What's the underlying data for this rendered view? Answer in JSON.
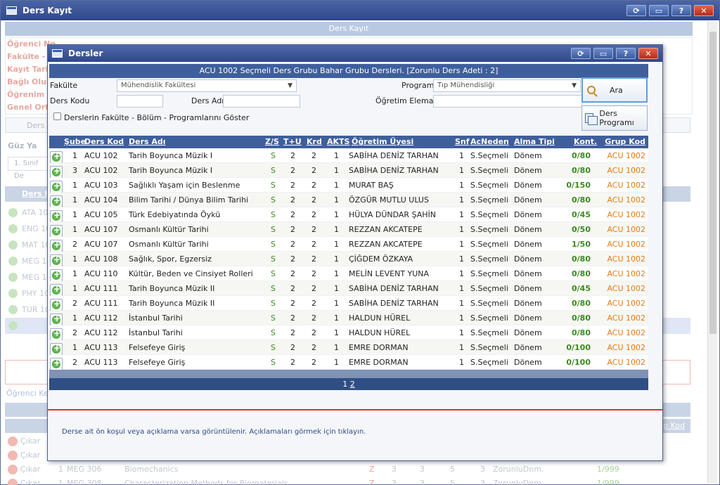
{
  "window": {
    "title": "Ders Kayıt",
    "header": "Ders Kayıt"
  },
  "background": {
    "info_rows": [
      "Öğrenci No",
      "Fakülte - P",
      "Kayıt Tarih",
      "Bağlı Olunan",
      "Öğrenim Sü",
      "Genel Orta"
    ],
    "bar_text": "Ders",
    "season": "Güz Ya",
    "class_combo": "1. Sınıf De",
    "band_label": "Ders K",
    "codes": [
      "ATA 10",
      "ENG 10",
      "MAT 10",
      "MEG 10",
      "MEG 10",
      "PHY 10",
      "TUR 10",
      ""
    ],
    "kesin": "Öğrenci Kesi",
    "grup_kod": "rup Kod",
    "bottom_rows": [
      {
        "label": "Çıkar",
        "sube": "",
        "kod": "",
        "ad": "",
        "zs": "",
        "a": "",
        "b": "",
        "c": "",
        "d": "",
        "acn": "",
        "kont": ""
      },
      {
        "label": "Çıkar",
        "sube": "",
        "kod": "",
        "ad": "",
        "zs": "",
        "a": "",
        "b": "",
        "c": "",
        "d": "",
        "acn": "",
        "kont": ""
      },
      {
        "label": "Çıkar",
        "sube": "1",
        "kod": "MEG 306",
        "ad": "Biomechanics",
        "zs": "Z",
        "a": "3",
        "b": "3",
        "c": "5",
        "d": "3",
        "acn": "ZorunluDnm.",
        "kont": "1/999"
      },
      {
        "label": "Çıkar",
        "sube": "1",
        "kod": "MEG 308",
        "ad": "Characterization Methods for Biomaterials",
        "zs": "Z",
        "a": "3",
        "b": "3",
        "c": "5",
        "d": "3",
        "acn": "ZorunluDnm.",
        "kont": "1/999"
      }
    ]
  },
  "dialog": {
    "title": "Dersler",
    "header": "ACU 1002 Seçmeli Ders Grubu Bahar Grubu Dersleri. [Zorunlu Ders Adeti : 2]",
    "form": {
      "fakulte_label": "Fakülte",
      "fakulte_value": "Mühendislik Fakültesi",
      "program_label": "Program",
      "program_value": "Tıp Mühendisliği",
      "ders_kodu_label": "Ders Kodu",
      "ders_adi_label": "Ders Adı",
      "ogretim_label": "Öğretim Elemanı",
      "checkbox_label": "Derslerin Fakülte - Bölüm - Programlarını Göster",
      "ara_label": "Ara",
      "ders_programi_label": "Ders Programı"
    },
    "columns": {
      "sube": "Şube",
      "kod": "Ders Kod",
      "ad": "Ders Adı",
      "zs": "Z/S",
      "tu": "T+U",
      "krd": "Krd",
      "akts": "AKTS",
      "ogr": "Öğretim Üyesi",
      "snf": "Snf",
      "acn": "AcNeden",
      "alma": "Alma Tipi",
      "kont": "Kont.",
      "grup": "Grup Kod"
    },
    "rows": [
      {
        "sube": "1",
        "kod": "ACU 102",
        "ad": "Tarih Boyunca Müzik I",
        "zs": "S",
        "tu": "2",
        "krd": "2",
        "akts": "1",
        "ogr": "SABİHA DENİZ TARHAN",
        "snf": "1",
        "acn": "S.Seçmeli",
        "alma": "Dönem",
        "kont": "0/80",
        "grup": "ACU 1002"
      },
      {
        "sube": "3",
        "kod": "ACU 102",
        "ad": "Tarih Boyunca Müzik I",
        "zs": "S",
        "tu": "2",
        "krd": "2",
        "akts": "1",
        "ogr": "SABİHA DENİZ TARHAN",
        "snf": "1",
        "acn": "S.Seçmeli",
        "alma": "Dönem",
        "kont": "0/80",
        "grup": "ACU 1002"
      },
      {
        "sube": "1",
        "kod": "ACU 103",
        "ad": "Sağlıklı Yaşam için Beslenme",
        "zs": "S",
        "tu": "2",
        "krd": "2",
        "akts": "1",
        "ogr": "MURAT BAŞ",
        "snf": "1",
        "acn": "S.Seçmeli",
        "alma": "Dönem",
        "kont": "0/150",
        "grup": "ACU 1002"
      },
      {
        "sube": "1",
        "kod": "ACU 104",
        "ad": "Bilim Tarihi / Dünya Bilim Tarihi",
        "zs": "S",
        "tu": "2",
        "krd": "2",
        "akts": "1",
        "ogr": "ÖZGÜR MUTLU ULUS",
        "snf": "1",
        "acn": "S.Seçmeli",
        "alma": "Dönem",
        "kont": "0/80",
        "grup": "ACU 1002"
      },
      {
        "sube": "1",
        "kod": "ACU 105",
        "ad": "Türk Edebiyatında Öykü",
        "zs": "S",
        "tu": "2",
        "krd": "2",
        "akts": "1",
        "ogr": "HÜLYA DÜNDAR ŞAHİN",
        "snf": "1",
        "acn": "S.Seçmeli",
        "alma": "Dönem",
        "kont": "0/45",
        "grup": "ACU 1002"
      },
      {
        "sube": "1",
        "kod": "ACU 107",
        "ad": "Osmanlı Kültür Tarihi",
        "zs": "S",
        "tu": "2",
        "krd": "2",
        "akts": "1",
        "ogr": "REZZAN AKCATEPE",
        "snf": "1",
        "acn": "S.Seçmeli",
        "alma": "Dönem",
        "kont": "0/50",
        "grup": "ACU 1002"
      },
      {
        "sube": "2",
        "kod": "ACU 107",
        "ad": "Osmanlı Kültür Tarihi",
        "zs": "S",
        "tu": "2",
        "krd": "2",
        "akts": "1",
        "ogr": "REZZAN AKCATEPE",
        "snf": "1",
        "acn": "S.Seçmeli",
        "alma": "Dönem",
        "kont": "1/50",
        "grup": "ACU 1002"
      },
      {
        "sube": "1",
        "kod": "ACU 108",
        "ad": "Sağlık, Spor, Egzersiz",
        "zs": "S",
        "tu": "2",
        "krd": "2",
        "akts": "1",
        "ogr": "ÇİĞDEM ÖZKAYA",
        "snf": "1",
        "acn": "S.Seçmeli",
        "alma": "Dönem",
        "kont": "0/80",
        "grup": "ACU 1002"
      },
      {
        "sube": "1",
        "kod": "ACU 110",
        "ad": "Kültür, Beden ve Cinsiyet Rolleri",
        "zs": "S",
        "tu": "2",
        "krd": "2",
        "akts": "1",
        "ogr": "MELİN LEVENT YUNA",
        "snf": "1",
        "acn": "S.Seçmeli",
        "alma": "Dönem",
        "kont": "0/80",
        "grup": "ACU 1002"
      },
      {
        "sube": "1",
        "kod": "ACU 111",
        "ad": "Tarih Boyunca Müzik II",
        "zs": "S",
        "tu": "2",
        "krd": "2",
        "akts": "1",
        "ogr": "SABİHA DENİZ TARHAN",
        "snf": "1",
        "acn": "S.Seçmeli",
        "alma": "Dönem",
        "kont": "0/45",
        "grup": "ACU 1002"
      },
      {
        "sube": "2",
        "kod": "ACU 111",
        "ad": "Tarih Boyunca Müzik II",
        "zs": "S",
        "tu": "2",
        "krd": "2",
        "akts": "1",
        "ogr": "SABİHA DENİZ TARHAN",
        "snf": "1",
        "acn": "S.Seçmeli",
        "alma": "Dönem",
        "kont": "0/80",
        "grup": "ACU 1002"
      },
      {
        "sube": "1",
        "kod": "ACU 112",
        "ad": "İstanbul Tarihi",
        "zs": "S",
        "tu": "2",
        "krd": "2",
        "akts": "1",
        "ogr": "HALDUN HÜREL",
        "snf": "1",
        "acn": "S.Seçmeli",
        "alma": "Dönem",
        "kont": "0/80",
        "grup": "ACU 1002"
      },
      {
        "sube": "2",
        "kod": "ACU 112",
        "ad": "İstanbul Tarihi",
        "zs": "S",
        "tu": "2",
        "krd": "2",
        "akts": "1",
        "ogr": "HALDUN HÜREL",
        "snf": "1",
        "acn": "S.Seçmeli",
        "alma": "Dönem",
        "kont": "0/80",
        "grup": "ACU 1002"
      },
      {
        "sube": "1",
        "kod": "ACU 113",
        "ad": "Felsefeye Giriş",
        "zs": "S",
        "tu": "2",
        "krd": "2",
        "akts": "1",
        "ogr": "EMRE DORMAN",
        "snf": "1",
        "acn": "S.Seçmeli",
        "alma": "Dönem",
        "kont": "0/100",
        "grup": "ACU 1002"
      },
      {
        "sube": "2",
        "kod": "ACU 113",
        "ad": "Felsefeye Giriş",
        "zs": "S",
        "tu": "2",
        "krd": "2",
        "akts": "1",
        "ogr": "EMRE DORMAN",
        "snf": "1",
        "acn": "S.Seçmeli",
        "alma": "Dönem",
        "kont": "0/100",
        "grup": "ACU 1002"
      }
    ],
    "pager": {
      "page1": "1",
      "page2": "2"
    },
    "note": "Derse ait ön koşul veya açıklama varsa görüntülenir. Açıklamaları görmek için tıklayın."
  }
}
